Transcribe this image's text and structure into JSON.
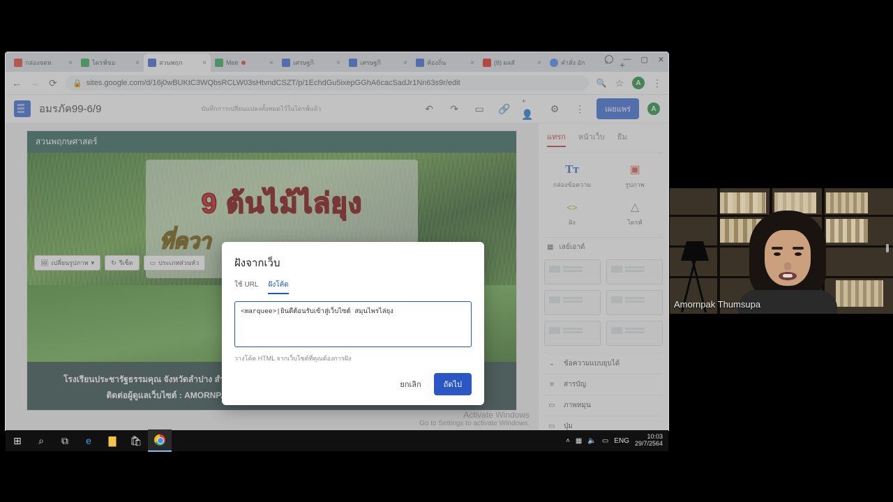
{
  "browser": {
    "tabs": [
      {
        "label": "กล่องจดห",
        "icon": "#e34133"
      },
      {
        "label": "ไดรฟ์ขอ",
        "icon": "#2da94f"
      },
      {
        "label": "สวนพฤก",
        "icon": "#3367d6",
        "active": true
      },
      {
        "label": "Mee",
        "icon": "#2da94f",
        "rec": true
      },
      {
        "label": "เศรษฐกิ",
        "icon": "#3367d6"
      },
      {
        "label": "เศรษฐกิ",
        "icon": "#3367d6"
      },
      {
        "label": "ห้องถิ่น",
        "icon": "#3367d6"
      },
      {
        "label": "(8) ผลสั",
        "icon": "#e62117"
      },
      {
        "label": "คำสั่ง อัก",
        "icon": "#4285f4"
      }
    ],
    "url": "sites.google.com/d/16j0wBUKtC3WQbsRCLW03sHtvndCSZT/p/1EchdGu5ixepGGhA6cacSadJr1Nn63s9r/edit",
    "avatar_letter": "A"
  },
  "sites": {
    "doc_title": "อมรภัค99-6/9",
    "save_hint": "บันทึกการเปลี่ยนแปลงทั้งหมดไว้ในไดรฟ์แล้ว",
    "publish": "เผยแพร่",
    "avatar_letter": "A"
  },
  "page": {
    "title": "สวนพฤกษศาสตร์",
    "slide_big": "9 ต้นไม้ไล่ยุง",
    "slide_sub": "ที่ควา",
    "edit_btns": {
      "a": "เปลี่ยนรูปภาพ",
      "b": "รีเซ็ต",
      "c": "ประเภทส่วนหัว"
    },
    "footer1": "โรงเรียนประชารัฐธรรมคุณ จังหวัดลำปาง สำนักงานเขตพื้นที่การศึกษามัธยมศึกษา เขต 35 สพฐ. กระทรวงศึกษาธิการ",
    "footer2": "ติดต่อผู้ดูแลเว็บไซต์ : AMORNPAK.T@OBEC.MOE.GO.TH    FB:AMORNPAK THUMSUPA"
  },
  "right": {
    "tabs": {
      "a": "แทรก",
      "b": "หน้าเว็บ",
      "c": "ธีม"
    },
    "items": {
      "text": "กล่องข้อความ",
      "image": "รูปภาพ",
      "embed": "ฝัง",
      "drive": "ไดรฟ์"
    },
    "layout": "เลย์เอาต์",
    "links": {
      "collapsible": "ข้อความแบบยุบได้",
      "toc": "สารบัญ",
      "carousel": "ภาพหมุน",
      "button": "ปุ่ม"
    }
  },
  "modal": {
    "title": "ฝังจากเว็บ",
    "tab_url": "ใช้ URL",
    "tab_code": "ฝังโค้ด",
    "textarea_value": "<marquee>|ยินดีต้อนรับเข้าสู่เว็บไซต์ สมุนไพรไล่ยุง",
    "hint": "วางโค้ด HTML จากเว็บไซต์ที่คุณต้องการฝัง",
    "cancel": "ยกเลิก",
    "next": "ถัดไป"
  },
  "winact": {
    "a": "Activate Windows",
    "b": "Go to Settings to activate Windows."
  },
  "taskbar": {
    "lang": "ENG",
    "time": "10:03",
    "date": "29/7/2564"
  },
  "webcam": {
    "name": "Amornpak Thumsupa"
  }
}
